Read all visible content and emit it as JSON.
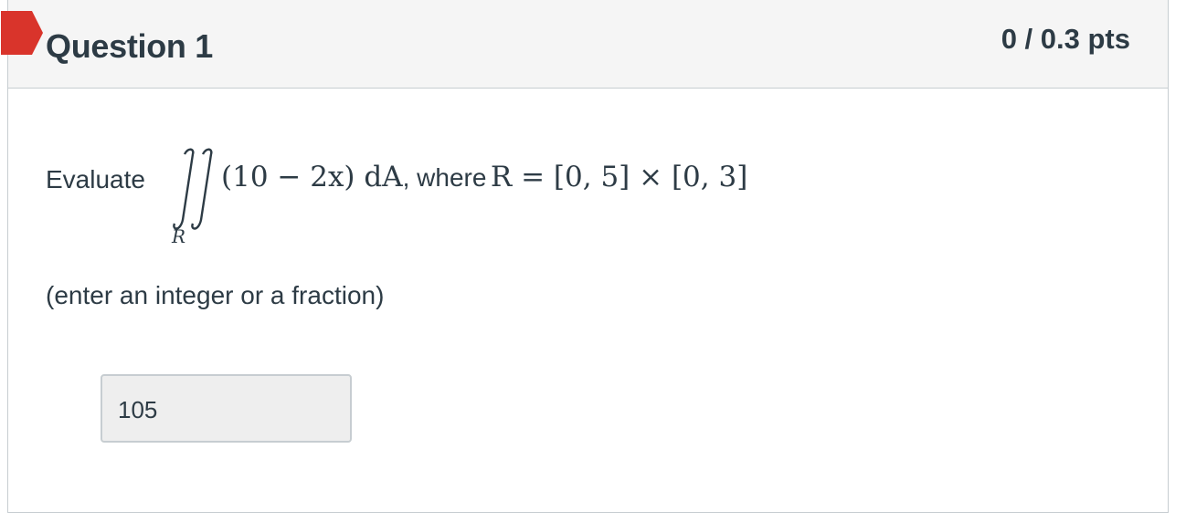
{
  "question": {
    "title": "Question 1",
    "points": "0 / 0.3 pts",
    "status_flag_color": "#d9342b",
    "prompt": {
      "lead": "Evaluate",
      "integral_symbol": "∬",
      "region_subscript": "R",
      "integrand": "(10 − 2x) dA",
      "connector": ", where",
      "region_definition": "R = [0, 5] × [0, 3]"
    },
    "hint": "(enter an integer or a fraction)",
    "answer": {
      "value": "105"
    }
  }
}
